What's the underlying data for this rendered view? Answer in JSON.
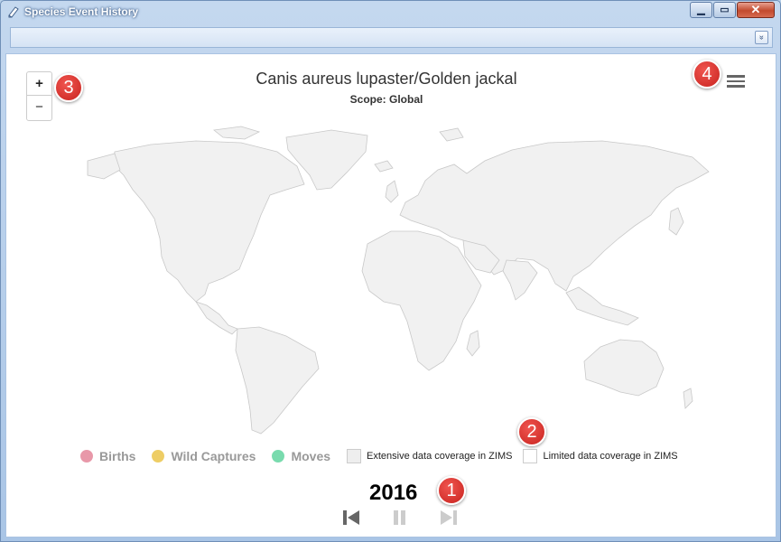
{
  "window": {
    "title": "Species Event History",
    "close_glyph": "✕",
    "minimize_glyph": "▁",
    "maximize_glyph": "▭"
  },
  "toolbar": {
    "expand_glyph": "»"
  },
  "map": {
    "title": "Canis aureus lupaster/Golden jackal",
    "subtitle": "Scope: Global",
    "zoom_in_label": "+",
    "zoom_out_label": "−",
    "land_color": "#f1f1f1",
    "border_color": "#c8c8c8"
  },
  "legend": {
    "items": [
      {
        "label": "Births",
        "color": "#f4a0b2"
      },
      {
        "label": "Wild Captures",
        "color": "#fbd86a"
      },
      {
        "label": "Moves",
        "color": "#7fe6b7"
      }
    ],
    "coverage": [
      {
        "label": "Extensive data coverage in ZIMS",
        "color": "#eeeeee"
      },
      {
        "label": "Limited data coverage in ZIMS",
        "color": "#ffffff"
      }
    ]
  },
  "timeline": {
    "year": "2016"
  },
  "badges": [
    "1",
    "2",
    "3",
    "4"
  ],
  "icons": {
    "title": "pen-icon",
    "menu": "hamburger-menu-icon",
    "first": "skip-to-start-icon",
    "pause": "pause-icon",
    "last": "skip-to-end-icon"
  }
}
